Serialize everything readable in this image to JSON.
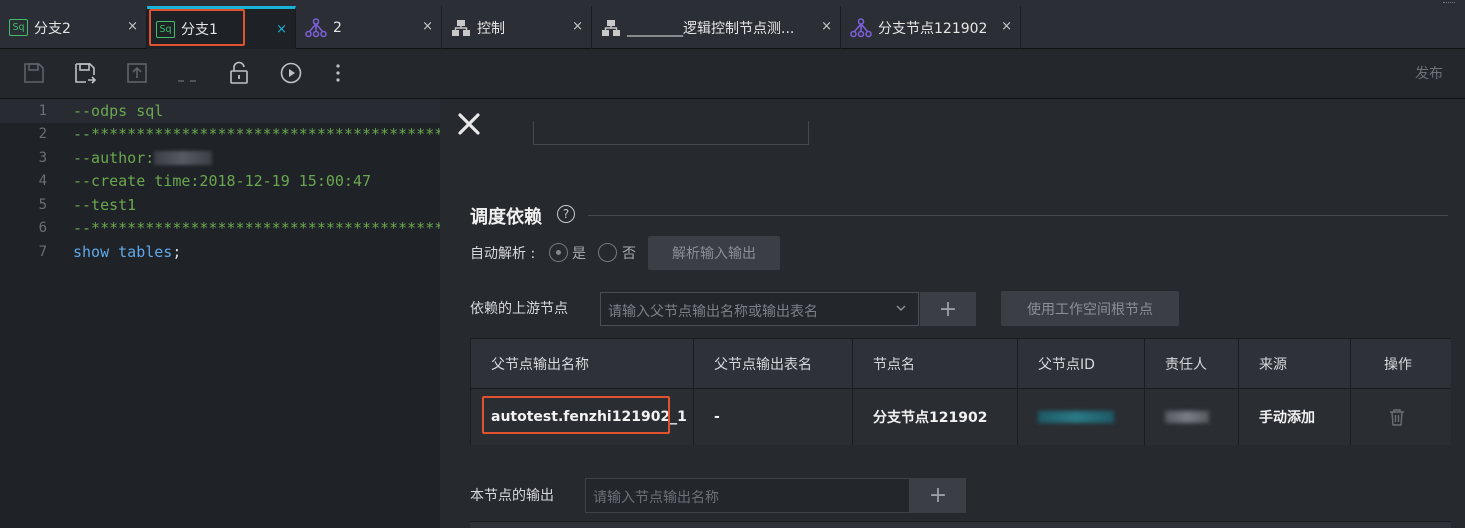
{
  "tabs": [
    {
      "icon": "sql-icon",
      "icon_text": "Sq",
      "label": "分支2",
      "close": "×"
    },
    {
      "icon": "sql-icon",
      "icon_text": "Sq",
      "label": "分支1",
      "close": "×",
      "active": true
    },
    {
      "icon": "workflow-icon",
      "label": "2",
      "close": "×"
    },
    {
      "icon": "control-node-icon",
      "label": "控制",
      "close": "×"
    },
    {
      "icon": "control-node-icon",
      "label": "________逻辑控制节点测...",
      "close": "×"
    },
    {
      "icon": "workflow-icon",
      "label": "分支节点121902",
      "close": "×"
    }
  ],
  "toolbar": {
    "items": [
      "save-icon",
      "save-as-icon",
      "submit-icon",
      "lock-icon",
      "run-icon",
      "more-icon"
    ],
    "publish_label": "发布"
  },
  "editor": {
    "lines": [
      {
        "num": "1",
        "text": "--odps sql"
      },
      {
        "num": "2",
        "text": "--**********************************************"
      },
      {
        "num": "3",
        "text": "--author:"
      },
      {
        "num": "4",
        "text": "--create time:2018-12-19 15:00:47"
      },
      {
        "num": "5",
        "text": "--test1"
      },
      {
        "num": "6",
        "text": "--**********************************************"
      },
      {
        "num": "7",
        "text_kw1": "show",
        "text_kw2": "tables",
        "text_end": ";"
      }
    ]
  },
  "panel": {
    "close_icon": "close-icon",
    "section_title": "调度依赖",
    "help": "?",
    "auto_parse": {
      "label": "自动解析 :",
      "yes": "是",
      "no": "否",
      "selected": "是",
      "button": "解析输入输出"
    },
    "upstream": {
      "label": "依赖的上游节点",
      "placeholder": "请输入父节点输出名称或输出表名",
      "add": "+",
      "root_button": "使用工作空间根节点"
    },
    "table": {
      "headers": [
        "父节点输出名称",
        "父节点输出表名",
        "节点名",
        "父节点ID",
        "责任人",
        "来源",
        "操作"
      ],
      "rows": [
        {
          "output_name": "autotest.fenzhi121902_1",
          "output_table": "-",
          "node_name": "分支节点121902",
          "source": "手动添加",
          "action_icon": "trash-icon"
        }
      ]
    },
    "output": {
      "label": "本节点的输出",
      "placeholder": "请输入节点输出名称",
      "add": "+"
    }
  },
  "colors": {
    "accent": "#1ab3d8",
    "highlight_box": "#e0532e",
    "sql_icon": "#3fbf6a",
    "workflow_icon": "#7b5fd6",
    "comment": "#6aa84f",
    "keyword": "#5fa8e8"
  }
}
